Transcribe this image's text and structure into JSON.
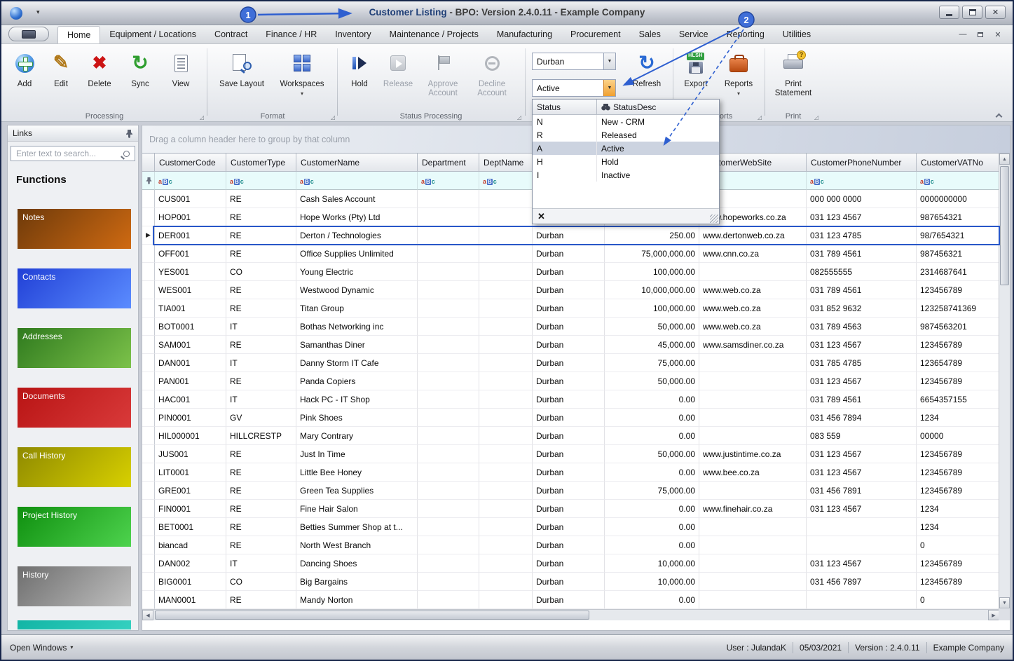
{
  "window": {
    "title_main": "Customer Listing",
    "title_rest": " - BPO: Version 2.4.0.11 - Example Company"
  },
  "active_tab": "Home",
  "tabs": [
    "Home",
    "Equipment / Locations",
    "Contract",
    "Finance / HR",
    "Inventory",
    "Maintenance / Projects",
    "Manufacturing",
    "Procurement",
    "Sales",
    "Service",
    "Reporting",
    "Utilities"
  ],
  "ribbon": {
    "groups": {
      "processing": "Processing",
      "format": "Format",
      "status_processing": "Status Processing",
      "reports": "Reports",
      "print": "Print"
    },
    "buttons": {
      "add": "Add",
      "edit": "Edit",
      "delete": "Delete",
      "sync": "Sync",
      "view": "View",
      "save_layout": "Save Layout",
      "workspaces": "Workspaces",
      "hold": "Hold",
      "release": "Release",
      "approve": "Approve Account",
      "decline": "Decline Account",
      "refresh": "Refresh",
      "export": "Export",
      "reports": "Reports",
      "print_statement": "Print Statement"
    },
    "export_badge": "HLSH",
    "branch_combo_value": "Durban",
    "status_combo_value": "Active"
  },
  "status_dropdown": {
    "columns": [
      "Status",
      "StatusDesc"
    ],
    "options": [
      [
        "N",
        "New - CRM"
      ],
      [
        "R",
        "Released"
      ],
      [
        "A",
        "Active"
      ],
      [
        "H",
        "Hold"
      ],
      [
        "I",
        "Inactive"
      ]
    ],
    "selected": "A"
  },
  "links_panel": {
    "title": "Links",
    "search_placeholder": "Enter text to search...",
    "functions_label": "Functions",
    "items": [
      {
        "label": "Notes",
        "c1": "#6e3a0a",
        "c2": "#cf6a12"
      },
      {
        "label": "Contacts",
        "c1": "#2140d6",
        "c2": "#5b8cff"
      },
      {
        "label": "Addresses",
        "c1": "#2f7a1e",
        "c2": "#7cc24a"
      },
      {
        "label": "Documents",
        "c1": "#b81414",
        "c2": "#d93a3a"
      },
      {
        "label": "Call History",
        "c1": "#8f8a00",
        "c2": "#d8d000"
      },
      {
        "label": "Project History",
        "c1": "#0f8f0f",
        "c2": "#4ed34e"
      },
      {
        "label": "History",
        "c1": "#6e6e6e",
        "c2": "#c0c0c0"
      },
      {
        "label": "",
        "c1": "#12b5a5",
        "c2": "#35d0c0"
      }
    ]
  },
  "grid": {
    "group_by_hint": "Drag a column header here to group by that column",
    "columns": [
      "CustomerCode",
      "CustomerType",
      "CustomerName",
      "Department",
      "DeptName",
      "",
      "",
      "CustomerWebSite",
      "CustomerPhoneNumber",
      "CustomerVATNo"
    ],
    "rows": [
      [
        "CUS001",
        "RE",
        "Cash Sales Account",
        "",
        "",
        "",
        "",
        "",
        "000 000 0000",
        "0000000000"
      ],
      [
        "HOP001",
        "RE",
        "Hope Works (Pty) Ltd",
        "",
        "",
        "",
        "",
        "www.hopeworks.co.za",
        "031 123 4567",
        "987654321"
      ],
      [
        "DER001",
        "RE",
        "Derton / Technologies",
        "",
        "",
        "Durban",
        "250.00",
        "www.dertonweb.co.za",
        "031 123 4785",
        "98/7654321"
      ],
      [
        "OFF001",
        "RE",
        "Office Supplies Unlimited",
        "",
        "",
        "Durban",
        "75,000,000.00",
        "www.cnn.co.za",
        "031 789 4561",
        "987456321"
      ],
      [
        "YES001",
        "CO",
        "Young Electric",
        "",
        "",
        "Durban",
        "100,000.00",
        "",
        "082555555",
        "2314687641"
      ],
      [
        "WES001",
        "RE",
        "Westwood Dynamic",
        "",
        "",
        "Durban",
        "10,000,000.00",
        "www.web.co.za",
        "031 789 4561",
        "123456789"
      ],
      [
        "TIA001",
        "RE",
        "Titan Group",
        "",
        "",
        "Durban",
        "100,000.00",
        "www.web.co.za",
        "031 852 9632",
        "123258741369"
      ],
      [
        "BOT0001",
        "IT",
        "Bothas Networking inc",
        "",
        "",
        "Durban",
        "50,000.00",
        "www.web.co.za",
        "031 789 4563",
        "9874563201"
      ],
      [
        "SAM001",
        "RE",
        "Samanthas Diner",
        "",
        "",
        "Durban",
        "45,000.00",
        "www.samsdiner.co.za",
        "031 123 4567",
        "123456789"
      ],
      [
        "DAN001",
        "IT",
        "Danny Storm IT Cafe",
        "",
        "",
        "Durban",
        "75,000.00",
        "",
        "031 785 4785",
        "123654789"
      ],
      [
        "PAN001",
        "RE",
        "Panda Copiers",
        "",
        "",
        "Durban",
        "50,000.00",
        "",
        "031 123 4567",
        "123456789"
      ],
      [
        "HAC001",
        "IT",
        "Hack PC - IT Shop",
        "",
        "",
        "Durban",
        "0.00",
        "",
        "031 789 4561",
        "6654357155"
      ],
      [
        "PIN0001",
        "GV",
        "Pink Shoes",
        "",
        "",
        "Durban",
        "0.00",
        "",
        "031 456 7894",
        "1234"
      ],
      [
        "HIL000001",
        "HILLCRESTP",
        "Mary Contrary",
        "",
        "",
        "Durban",
        "0.00",
        "",
        "083 559",
        "00000"
      ],
      [
        "JUS001",
        "RE",
        "Just In Time",
        "",
        "",
        "Durban",
        "50,000.00",
        "www.justintime.co.za",
        "031 123 4567",
        "123456789"
      ],
      [
        "LIT0001",
        "RE",
        "Little Bee Honey",
        "",
        "",
        "Durban",
        "0.00",
        "www.bee.co.za",
        "031 123 4567",
        "123456789"
      ],
      [
        "GRE001",
        "RE",
        "Green Tea Supplies",
        "",
        "",
        "Durban",
        "75,000.00",
        "",
        "031 456 7891",
        "123456789"
      ],
      [
        "FIN0001",
        "RE",
        "Fine Hair Salon",
        "",
        "",
        "Durban",
        "0.00",
        "www.finehair.co.za",
        "031 123 4567",
        "1234"
      ],
      [
        "BET0001",
        "RE",
        "Betties Summer Shop at t...",
        "",
        "",
        "Durban",
        "0.00",
        "",
        "",
        "1234"
      ],
      [
        "biancad",
        "RE",
        "North West Branch",
        "",
        "",
        "Durban",
        "0.00",
        "",
        "",
        "0"
      ],
      [
        "DAN002",
        "IT",
        "Dancing Shoes",
        "",
        "",
        "Durban",
        "10,000.00",
        "",
        "031 123 4567",
        "123456789"
      ],
      [
        "BIG0001",
        "CO",
        "Big Bargains",
        "",
        "",
        "Durban",
        "10,000.00",
        "",
        "031 456 7897",
        "123456789"
      ],
      [
        "MAN0001",
        "RE",
        "Mandy Norton",
        "",
        "",
        "Durban",
        "0.00",
        "",
        "",
        "0"
      ]
    ],
    "selected_row": "DER001"
  },
  "statusbar": {
    "open_windows": "Open Windows",
    "user": "User : JulandaK",
    "date": "05/03/2021",
    "version": "Version : 2.4.0.11",
    "company": "Example Company"
  },
  "callouts": [
    "1",
    "2"
  ]
}
